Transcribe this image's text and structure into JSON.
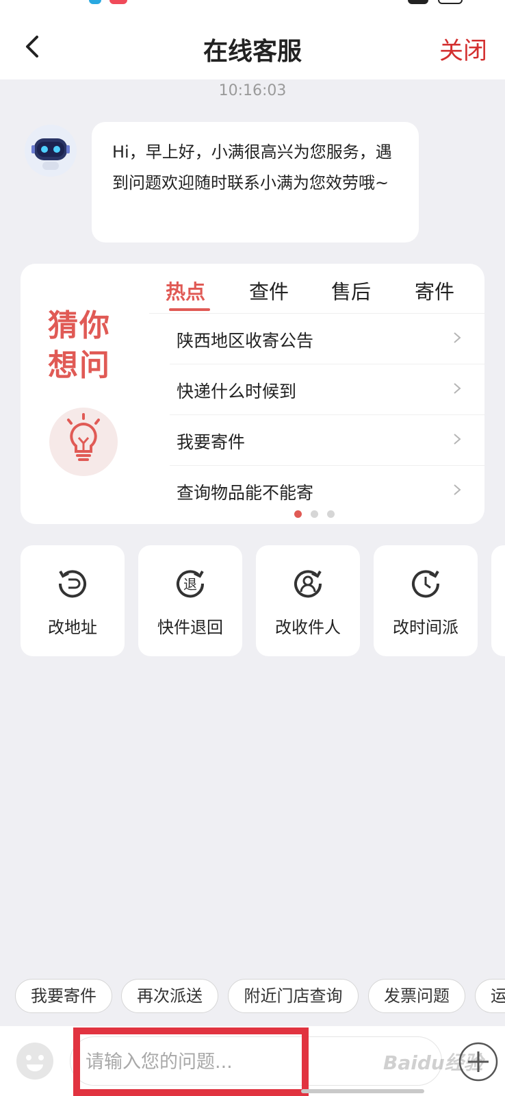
{
  "header": {
    "title": "在线客服",
    "close_label": "关闭"
  },
  "chat": {
    "timestamp": "10:16:03",
    "bot_message": "Hi，早上好，小满很高兴为您服务，遇到问题欢迎随时联系小满为您效劳哦~"
  },
  "guess_card": {
    "heading": "猜你想问",
    "tabs": [
      {
        "label": "热点",
        "active": true
      },
      {
        "label": "查件",
        "active": false
      },
      {
        "label": "售后",
        "active": false
      },
      {
        "label": "寄件",
        "active": false
      }
    ],
    "questions": [
      "陕西地区收寄公告",
      "快递什么时候到",
      "我要寄件",
      "查询物品能不能寄"
    ],
    "pagination": {
      "pages": 3,
      "current": 1
    }
  },
  "actions": [
    {
      "label": "改地址",
      "icon": "change-address-icon"
    },
    {
      "label": "快件退回",
      "icon": "return-parcel-icon"
    },
    {
      "label": "改收件人",
      "icon": "change-recipient-icon"
    },
    {
      "label": "改时间派",
      "icon": "change-delivery-time-icon"
    }
  ],
  "quick_chips": [
    "我要寄件",
    "再次派送",
    "附近门店查询",
    "发票问题",
    "运"
  ],
  "input": {
    "placeholder": "请输入您的问题..."
  },
  "watermark": "Baidu经验",
  "colors": {
    "accent": "#e05a55",
    "close": "#d32f2f",
    "highlight": "#e13340",
    "background": "#efeff3"
  }
}
